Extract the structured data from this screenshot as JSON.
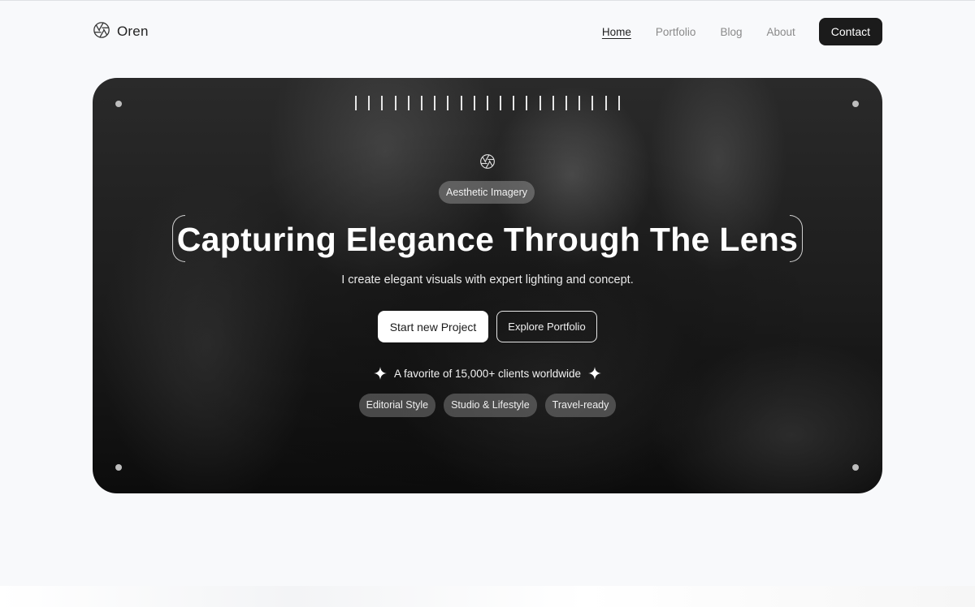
{
  "header": {
    "brand": "Oren",
    "nav": [
      {
        "label": "Home",
        "active": true
      },
      {
        "label": "Portfolio",
        "active": false
      },
      {
        "label": "Blog",
        "active": false
      },
      {
        "label": "About",
        "active": false
      }
    ],
    "contact_label": "Contact"
  },
  "hero": {
    "badge": "Aesthetic Imagery",
    "headline": "Capturing Elegance Through The Lens",
    "subline": "I create elegant visuals with expert lighting and concept.",
    "primary_button": "Start new Project",
    "secondary_button": "Explore Portfolio",
    "favorite_text": "A favorite of 15,000+ clients worldwide",
    "tags": [
      "Editorial Style",
      "Studio & Lifestyle",
      "Travel-ready"
    ]
  },
  "icons": {
    "brand": "aperture-icon",
    "hero": "aperture-icon",
    "favorite": "sparkle-icon"
  },
  "colors": {
    "background": "#f8f9fb",
    "accent": "#1b1b1b",
    "hero_text": "#ffffff"
  }
}
